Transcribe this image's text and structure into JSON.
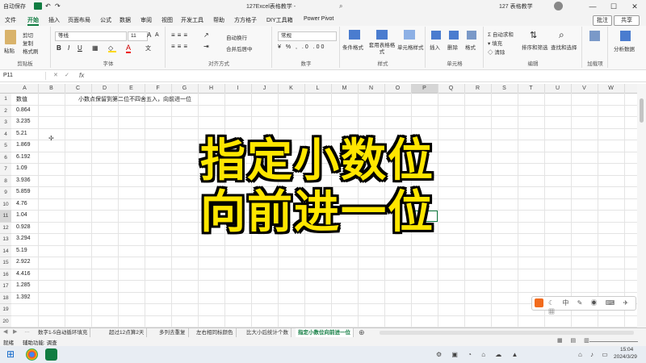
{
  "titlebar": {
    "autosave": "自动保存",
    "doc_title": "127Excel表格教学 -",
    "user": "127 表格教学"
  },
  "menu": [
    "文件",
    "开始",
    "插入",
    "页面布局",
    "公式",
    "数据",
    "审阅",
    "视图",
    "开发工具",
    "帮助",
    "方方格子",
    "DIY工具箱",
    "Power Pivot"
  ],
  "menu_right": {
    "comment": "批注",
    "share": "共享"
  },
  "ribbon": {
    "clipboard": {
      "paste": "粘贴",
      "cut": "剪切",
      "copy": "复制",
      "format_painter": "格式刷",
      "label": "剪贴板"
    },
    "font": {
      "name": "等线",
      "size": "11",
      "label": "字体"
    },
    "alignment": {
      "wrap": "自动换行",
      "merge": "合并后居中",
      "label": "对齐方式"
    },
    "number": {
      "format": "常规",
      "label": "数字"
    },
    "styles": {
      "conditional": "条件格式",
      "table": "套用表格格式",
      "cell": "单元格样式",
      "label": "样式"
    },
    "cells": {
      "insert": "插入",
      "delete": "删除",
      "format": "格式",
      "label": "单元格"
    },
    "editing": {
      "autosum": "自动求和",
      "fill": "填充",
      "clear": "清除",
      "sort": "排序和筛选",
      "find": "查找和选择",
      "label": "编辑"
    },
    "addins": {
      "label": "加载项",
      "analyze": "分析数据"
    }
  },
  "formula_bar": {
    "name_box": "P11",
    "fx": "fx",
    "content": ""
  },
  "columns": [
    "A",
    "B",
    "C",
    "D",
    "E",
    "F",
    "G",
    "H",
    "I",
    "J",
    "K",
    "L",
    "M",
    "N",
    "O",
    "P",
    "Q",
    "R",
    "S",
    "T",
    "U",
    "V",
    "W"
  ],
  "rows": [
    "1",
    "2",
    "3",
    "4",
    "5",
    "6",
    "7",
    "8",
    "9",
    "10",
    "11",
    "12",
    "13",
    "14",
    "15",
    "16",
    "17",
    "18",
    "19",
    "20"
  ],
  "column_a": [
    "数值",
    "0.864",
    "3.235",
    "5.21",
    "1.869",
    "6.192",
    "1.09",
    "3.936",
    "5.859",
    "4.76",
    "1.04",
    "0.928",
    "3.294",
    "5.19",
    "2.922",
    "4.416",
    "1.285",
    "1.392"
  ],
  "note_d1": "小数点保留到第二位不四舍五入，向前进一位",
  "overlay": {
    "line1": "指定小数位",
    "line2": "向前进一位"
  },
  "sheet_tabs": [
    "数字1-5自动循环填充",
    "超过12点算2天",
    "多列去重复",
    "左右相同标颜色",
    "比大小后统计个数",
    "指定小数位向前进一位"
  ],
  "active_tab_index": 5,
  "status": {
    "ready": "就绪",
    "accessibility": "辅助功能: 调查"
  },
  "taskbar": {
    "time": "15:04",
    "date": "2024/3/29"
  }
}
